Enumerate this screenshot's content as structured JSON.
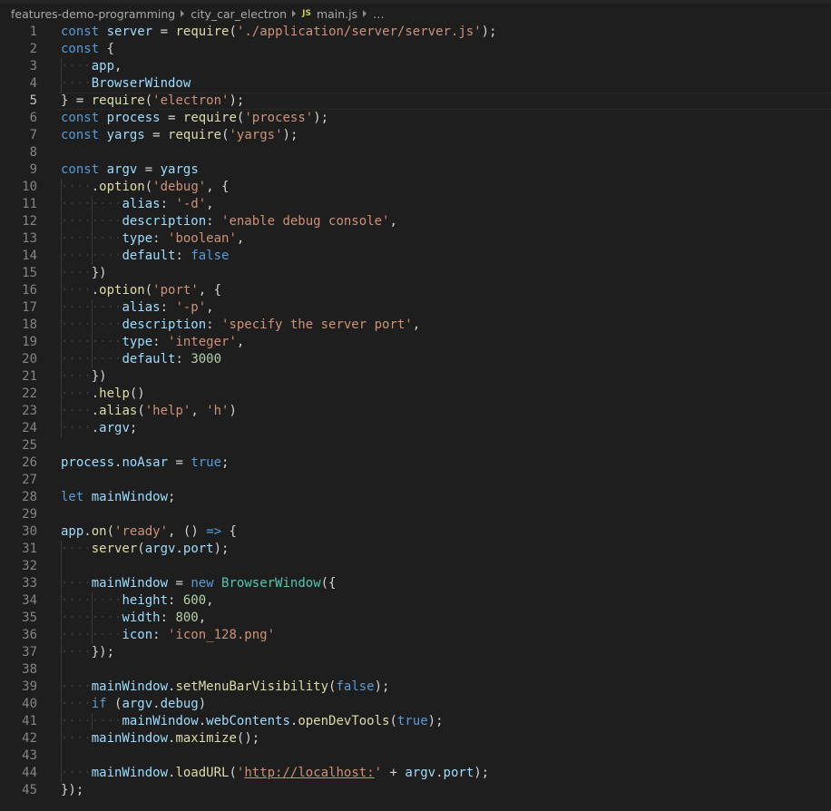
{
  "breadcrumbs": {
    "items": [
      "features-demo-programming",
      "city_car_electron",
      "main.js",
      "…"
    ],
    "file_badge": "JS"
  },
  "editor": {
    "current_line": 5,
    "lines": [
      {
        "n": "1",
        "indent": 0,
        "tokens": [
          [
            "k",
            "const"
          ],
          [
            "p",
            " "
          ],
          [
            "v",
            "server"
          ],
          [
            "p",
            " = "
          ],
          [
            "f",
            "require"
          ],
          [
            "p",
            "("
          ],
          [
            "s",
            "'./application/server/server.js'"
          ],
          [
            "p",
            ");"
          ]
        ]
      },
      {
        "n": "2",
        "indent": 0,
        "tokens": [
          [
            "k",
            "const"
          ],
          [
            "p",
            " {"
          ]
        ]
      },
      {
        "n": "3",
        "indent": 1,
        "tokens": [
          [
            "v",
            "app"
          ],
          [
            "p",
            ","
          ]
        ]
      },
      {
        "n": "4",
        "indent": 1,
        "tokens": [
          [
            "v",
            "BrowserWindow"
          ]
        ]
      },
      {
        "n": "5",
        "indent": 0,
        "tokens": [
          [
            "p",
            "} = "
          ],
          [
            "f",
            "require"
          ],
          [
            "p",
            "("
          ],
          [
            "s",
            "'electron'"
          ],
          [
            "p",
            ");"
          ]
        ]
      },
      {
        "n": "6",
        "indent": 0,
        "tokens": [
          [
            "k",
            "const"
          ],
          [
            "p",
            " "
          ],
          [
            "v",
            "process"
          ],
          [
            "p",
            " = "
          ],
          [
            "f",
            "require"
          ],
          [
            "p",
            "("
          ],
          [
            "s",
            "'process'"
          ],
          [
            "p",
            ");"
          ]
        ]
      },
      {
        "n": "7",
        "indent": 0,
        "tokens": [
          [
            "k",
            "const"
          ],
          [
            "p",
            " "
          ],
          [
            "v",
            "yargs"
          ],
          [
            "p",
            " = "
          ],
          [
            "f",
            "require"
          ],
          [
            "p",
            "("
          ],
          [
            "s",
            "'yargs'"
          ],
          [
            "p",
            ");"
          ]
        ]
      },
      {
        "n": "8",
        "indent": 0,
        "tokens": []
      },
      {
        "n": "9",
        "indent": 0,
        "tokens": [
          [
            "k",
            "const"
          ],
          [
            "p",
            " "
          ],
          [
            "v",
            "argv"
          ],
          [
            "p",
            " = "
          ],
          [
            "v",
            "yargs"
          ]
        ]
      },
      {
        "n": "10",
        "indent": 1,
        "tokens": [
          [
            "p",
            "."
          ],
          [
            "f",
            "option"
          ],
          [
            "p",
            "("
          ],
          [
            "s",
            "'debug'"
          ],
          [
            "p",
            ", {"
          ]
        ]
      },
      {
        "n": "11",
        "indent": 2,
        "tokens": [
          [
            "v",
            "alias"
          ],
          [
            "p",
            ": "
          ],
          [
            "s",
            "'-d'"
          ],
          [
            "p",
            ","
          ]
        ]
      },
      {
        "n": "12",
        "indent": 2,
        "tokens": [
          [
            "v",
            "description"
          ],
          [
            "p",
            ": "
          ],
          [
            "s",
            "'enable debug console'"
          ],
          [
            "p",
            ","
          ]
        ]
      },
      {
        "n": "13",
        "indent": 2,
        "tokens": [
          [
            "v",
            "type"
          ],
          [
            "p",
            ": "
          ],
          [
            "s",
            "'boolean'"
          ],
          [
            "p",
            ","
          ]
        ]
      },
      {
        "n": "14",
        "indent": 2,
        "tokens": [
          [
            "v",
            "default"
          ],
          [
            "p",
            ": "
          ],
          [
            "k",
            "false"
          ]
        ]
      },
      {
        "n": "15",
        "indent": 1,
        "tokens": [
          [
            "p",
            "})"
          ]
        ]
      },
      {
        "n": "16",
        "indent": 1,
        "tokens": [
          [
            "p",
            "."
          ],
          [
            "f",
            "option"
          ],
          [
            "p",
            "("
          ],
          [
            "s",
            "'port'"
          ],
          [
            "p",
            ", {"
          ]
        ]
      },
      {
        "n": "17",
        "indent": 2,
        "tokens": [
          [
            "v",
            "alias"
          ],
          [
            "p",
            ": "
          ],
          [
            "s",
            "'-p'"
          ],
          [
            "p",
            ","
          ]
        ]
      },
      {
        "n": "18",
        "indent": 2,
        "tokens": [
          [
            "v",
            "description"
          ],
          [
            "p",
            ": "
          ],
          [
            "s",
            "'specify the server port'"
          ],
          [
            "p",
            ","
          ]
        ]
      },
      {
        "n": "19",
        "indent": 2,
        "tokens": [
          [
            "v",
            "type"
          ],
          [
            "p",
            ": "
          ],
          [
            "s",
            "'integer'"
          ],
          [
            "p",
            ","
          ]
        ]
      },
      {
        "n": "20",
        "indent": 2,
        "tokens": [
          [
            "v",
            "default"
          ],
          [
            "p",
            ": "
          ],
          [
            "n",
            "3000"
          ]
        ]
      },
      {
        "n": "21",
        "indent": 1,
        "tokens": [
          [
            "p",
            "})"
          ]
        ]
      },
      {
        "n": "22",
        "indent": 1,
        "tokens": [
          [
            "p",
            "."
          ],
          [
            "f",
            "help"
          ],
          [
            "p",
            "()"
          ]
        ]
      },
      {
        "n": "23",
        "indent": 1,
        "tokens": [
          [
            "p",
            "."
          ],
          [
            "f",
            "alias"
          ],
          [
            "p",
            "("
          ],
          [
            "s",
            "'help'"
          ],
          [
            "p",
            ", "
          ],
          [
            "s",
            "'h'"
          ],
          [
            "p",
            ")"
          ]
        ]
      },
      {
        "n": "24",
        "indent": 1,
        "tokens": [
          [
            "p",
            "."
          ],
          [
            "v",
            "argv"
          ],
          [
            "p",
            ";"
          ]
        ]
      },
      {
        "n": "25",
        "indent": 0,
        "tokens": []
      },
      {
        "n": "26",
        "indent": 0,
        "tokens": [
          [
            "v",
            "process"
          ],
          [
            "p",
            "."
          ],
          [
            "v",
            "noAsar"
          ],
          [
            "p",
            " = "
          ],
          [
            "k",
            "true"
          ],
          [
            "p",
            ";"
          ]
        ]
      },
      {
        "n": "27",
        "indent": 0,
        "tokens": []
      },
      {
        "n": "28",
        "indent": 0,
        "tokens": [
          [
            "k",
            "let"
          ],
          [
            "p",
            " "
          ],
          [
            "v",
            "mainWindow"
          ],
          [
            "p",
            ";"
          ]
        ]
      },
      {
        "n": "29",
        "indent": 0,
        "tokens": []
      },
      {
        "n": "30",
        "indent": 0,
        "tokens": [
          [
            "v",
            "app"
          ],
          [
            "p",
            "."
          ],
          [
            "f",
            "on"
          ],
          [
            "p",
            "("
          ],
          [
            "s",
            "'ready'"
          ],
          [
            "p",
            ", () "
          ],
          [
            "k",
            "=>"
          ],
          [
            "p",
            " {"
          ]
        ]
      },
      {
        "n": "31",
        "indent": 1,
        "tokens": [
          [
            "f",
            "server"
          ],
          [
            "p",
            "("
          ],
          [
            "v",
            "argv"
          ],
          [
            "p",
            "."
          ],
          [
            "v",
            "port"
          ],
          [
            "p",
            ");"
          ]
        ]
      },
      {
        "n": "32",
        "indent": 0,
        "tokens": []
      },
      {
        "n": "33",
        "indent": 1,
        "tokens": [
          [
            "v",
            "mainWindow"
          ],
          [
            "p",
            " = "
          ],
          [
            "k",
            "new"
          ],
          [
            "p",
            " "
          ],
          [
            "t",
            "BrowserWindow"
          ],
          [
            "p",
            "({"
          ]
        ]
      },
      {
        "n": "34",
        "indent": 2,
        "tokens": [
          [
            "v",
            "height"
          ],
          [
            "p",
            ": "
          ],
          [
            "n",
            "600"
          ],
          [
            "p",
            ","
          ]
        ]
      },
      {
        "n": "35",
        "indent": 2,
        "tokens": [
          [
            "v",
            "width"
          ],
          [
            "p",
            ": "
          ],
          [
            "n",
            "800"
          ],
          [
            "p",
            ","
          ]
        ]
      },
      {
        "n": "36",
        "indent": 2,
        "tokens": [
          [
            "v",
            "icon"
          ],
          [
            "p",
            ": "
          ],
          [
            "s",
            "'icon_128.png'"
          ]
        ]
      },
      {
        "n": "37",
        "indent": 1,
        "tokens": [
          [
            "p",
            "});"
          ]
        ]
      },
      {
        "n": "38",
        "indent": 0,
        "tokens": []
      },
      {
        "n": "39",
        "indent": 1,
        "tokens": [
          [
            "v",
            "mainWindow"
          ],
          [
            "p",
            "."
          ],
          [
            "f",
            "setMenuBarVisibility"
          ],
          [
            "p",
            "("
          ],
          [
            "k",
            "false"
          ],
          [
            "p",
            ");"
          ]
        ]
      },
      {
        "n": "40",
        "indent": 1,
        "tokens": [
          [
            "k",
            "if"
          ],
          [
            "p",
            " ("
          ],
          [
            "v",
            "argv"
          ],
          [
            "p",
            "."
          ],
          [
            "v",
            "debug"
          ],
          [
            "p",
            ")"
          ]
        ]
      },
      {
        "n": "41",
        "indent": 2,
        "tokens": [
          [
            "v",
            "mainWindow"
          ],
          [
            "p",
            "."
          ],
          [
            "v",
            "webContents"
          ],
          [
            "p",
            "."
          ],
          [
            "f",
            "openDevTools"
          ],
          [
            "p",
            "("
          ],
          [
            "k",
            "true"
          ],
          [
            "p",
            ");"
          ]
        ]
      },
      {
        "n": "42",
        "indent": 1,
        "tokens": [
          [
            "v",
            "mainWindow"
          ],
          [
            "p",
            "."
          ],
          [
            "f",
            "maximize"
          ],
          [
            "p",
            "();"
          ]
        ]
      },
      {
        "n": "43",
        "indent": 0,
        "tokens": []
      },
      {
        "n": "44",
        "indent": 1,
        "tokens": [
          [
            "v",
            "mainWindow"
          ],
          [
            "p",
            "."
          ],
          [
            "f",
            "loadURL"
          ],
          [
            "p",
            "("
          ],
          [
            "s",
            "'"
          ],
          [
            "su",
            "http://localhost:"
          ],
          [
            "s",
            "'"
          ],
          [
            "p",
            " + "
          ],
          [
            "v",
            "argv"
          ],
          [
            "p",
            "."
          ],
          [
            "v",
            "port"
          ],
          [
            "p",
            ");"
          ]
        ]
      },
      {
        "n": "45",
        "indent": 0,
        "tokens": [
          [
            "p",
            "});"
          ]
        ]
      }
    ]
  }
}
